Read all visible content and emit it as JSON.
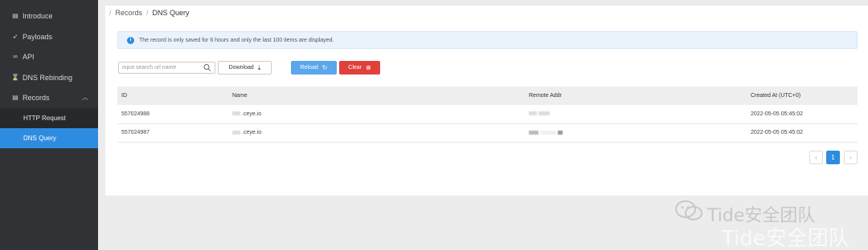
{
  "sidebar": {
    "items": [
      {
        "label": "Introduce",
        "icon": "document-icon"
      },
      {
        "label": "Payloads",
        "icon": "rocket-icon"
      },
      {
        "label": "API",
        "icon": "link-icon"
      },
      {
        "label": "DNS Rebinding",
        "icon": "hourglass-icon"
      },
      {
        "label": "Records",
        "icon": "list-icon"
      }
    ],
    "subitems": [
      {
        "label": "HTTP Request"
      },
      {
        "label": "DNS Query"
      }
    ]
  },
  "breadcrumb": {
    "items": [
      "Records",
      "DNS Query"
    ]
  },
  "alert": {
    "text": "The record is only saved for 6 hours and only the last 100 items are displayed."
  },
  "search": {
    "placeholder": "input search url name"
  },
  "buttons": {
    "download": "Download",
    "reload": "Reload",
    "clear": "Clear"
  },
  "table": {
    "columns": [
      "ID",
      "Name",
      "Remote Addr",
      "Created At (UTC+0)"
    ],
    "rows": [
      {
        "id": "557024988",
        "name": ".ceye.io",
        "created": "2022-05-05 05:45:02"
      },
      {
        "id": "557024987",
        "name": ".ceye.io",
        "created": "2022-05-05 05:45:02"
      }
    ]
  },
  "pagination": {
    "prev": "‹",
    "current": "1",
    "next": "›"
  },
  "watermark": {
    "line1": "Tide安全团队",
    "line2": "Tide安全团队"
  },
  "colors": {
    "accent": "#2e8ce0",
    "danger": "#e0413b",
    "sidebar": "#2f3336"
  }
}
